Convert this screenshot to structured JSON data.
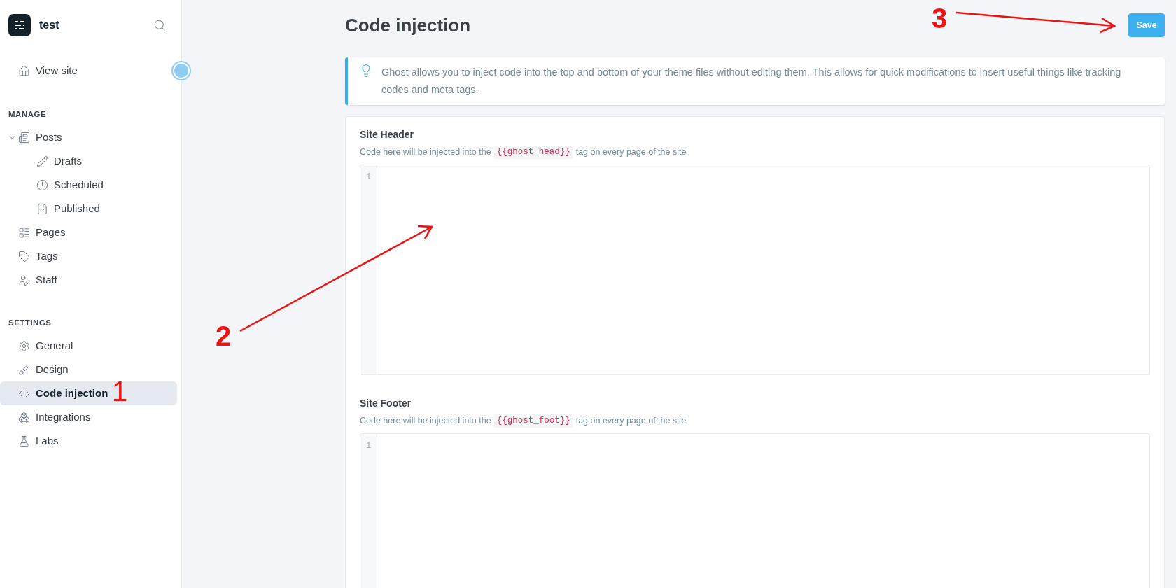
{
  "brand": {
    "name": "test"
  },
  "sidebar": {
    "top": [
      {
        "label": "View site",
        "selected": false
      }
    ],
    "sections": [
      {
        "title": "MANAGE",
        "items": [
          {
            "label": "Posts",
            "selected": false,
            "expanded": true,
            "children": [
              {
                "label": "Drafts",
                "selected": false
              },
              {
                "label": "Scheduled",
                "selected": false
              },
              {
                "label": "Published",
                "selected": false
              }
            ]
          },
          {
            "label": "Pages",
            "selected": false
          },
          {
            "label": "Tags",
            "selected": false
          },
          {
            "label": "Staff",
            "selected": false
          }
        ]
      },
      {
        "title": "SETTINGS",
        "items": [
          {
            "label": "General",
            "selected": false
          },
          {
            "label": "Design",
            "selected": false
          },
          {
            "label": "Code injection",
            "selected": true
          },
          {
            "label": "Integrations",
            "selected": false
          },
          {
            "label": "Labs",
            "selected": false
          }
        ]
      }
    ]
  },
  "page": {
    "title": "Code injection",
    "save_button": "Save"
  },
  "info": "Ghost allows you to inject code into the top and bottom of your theme files without editing them. This allows for quick modifications to insert useful things like tracking codes and meta tags.",
  "editors": [
    {
      "title": "Site Header",
      "hint_before": "Code here will be injected into the",
      "code": "{{ghost_head}}",
      "hint_after": "tag on every page of the site",
      "line_number": "1"
    },
    {
      "title": "Site Footer",
      "hint_before": "Code here will be injected into the",
      "code": "{{ghost_foot}}",
      "hint_after": "tag on every page of the site",
      "line_number": "1"
    }
  ],
  "annotations": [
    "1",
    "2",
    "3"
  ]
}
